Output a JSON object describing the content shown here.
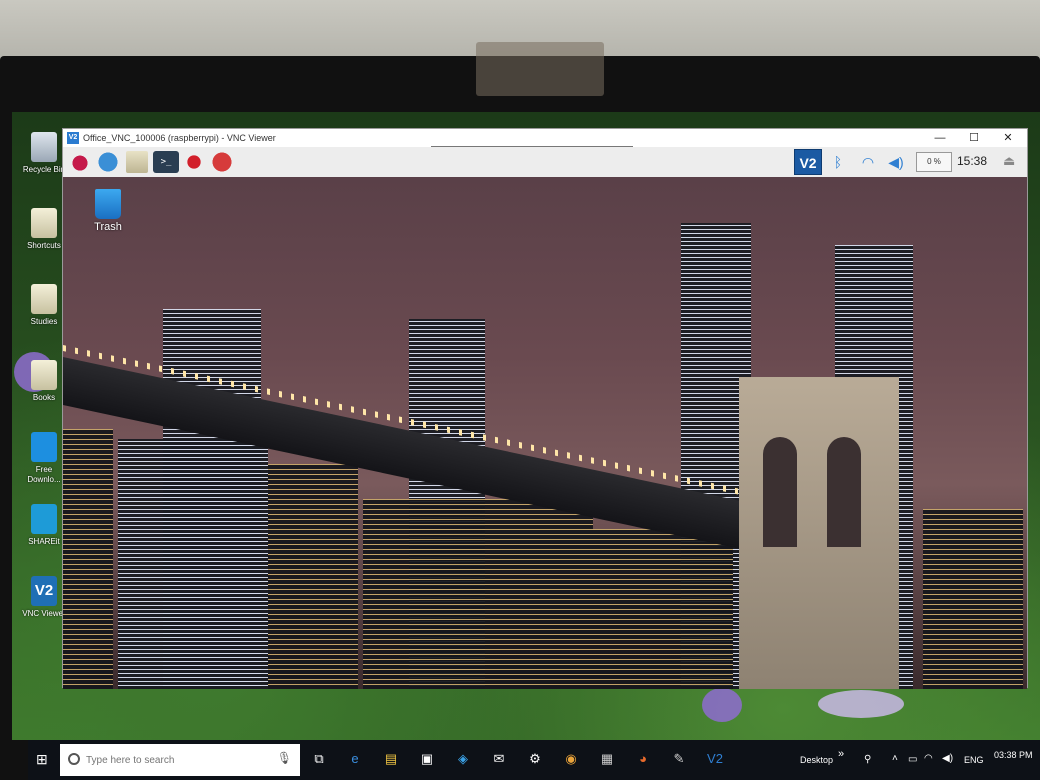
{
  "desktop_icons": [
    {
      "label": "Recycle Bin",
      "icon": "recycle-bin-icon"
    },
    {
      "label": "Shortcuts",
      "icon": "folder-icon"
    },
    {
      "label": "Studies",
      "icon": "folder-icon"
    },
    {
      "label": "Books",
      "icon": "folder-icon"
    },
    {
      "label": "Free Downlo...",
      "icon": "free-download-manager-icon"
    },
    {
      "label": "SHAREit",
      "icon": "shareit-icon"
    },
    {
      "label": "VNC Viewer",
      "icon": "vnc-viewer-icon"
    }
  ],
  "vnc_window": {
    "title": "Office_VNC_100006 (raspberrypi) - VNC Viewer",
    "logo_text": "V2",
    "controls": {
      "minimize": "—",
      "maximize": "☐",
      "close": "✕"
    }
  },
  "rpi_panel": {
    "terminal_glyph": ">_",
    "tray": {
      "vnc_badge": "V2",
      "bluetooth": "ᛒ",
      "wifi": "◠",
      "volume": "◀)",
      "cpu": "0 %",
      "clock": "15:38",
      "eject": "⏏"
    }
  },
  "remote_desktop": {
    "trash_label": "Trash"
  },
  "taskbar": {
    "start_glyph": "⊞",
    "search_placeholder": "Type here to search",
    "mic_glyph": "🎙",
    "pinned": [
      {
        "name": "task-view-icon",
        "glyph": "⧉",
        "color": "#ffffff"
      },
      {
        "name": "edge-icon",
        "glyph": "e",
        "color": "#3b8fe0"
      },
      {
        "name": "file-explorer-icon",
        "glyph": "▤",
        "color": "#f2c744"
      },
      {
        "name": "store-icon",
        "glyph": "▣",
        "color": "#ffffff"
      },
      {
        "name": "app-icon",
        "glyph": "◈",
        "color": "#3aa1e6"
      },
      {
        "name": "mail-icon",
        "glyph": "✉",
        "color": "#ffffff"
      },
      {
        "name": "settings-icon",
        "glyph": "⚙",
        "color": "#ffffff"
      },
      {
        "name": "chrome-icon",
        "glyph": "◉",
        "color": "#e8a33b"
      },
      {
        "name": "calculator-icon",
        "glyph": "▦",
        "color": "#cccccc"
      },
      {
        "name": "firefox-icon",
        "glyph": "◕",
        "color": "#e66a2c"
      },
      {
        "name": "paint-icon",
        "glyph": "✎",
        "color": "#cccccc"
      },
      {
        "name": "vnc-taskbar-icon",
        "glyph": "V2",
        "color": "#2f7fd2"
      }
    ],
    "desktop_label": "Desktop",
    "chevron": "»",
    "tray_lang": "ENG",
    "time": "03:38 PM"
  },
  "colors": {
    "taskbar_bg": "#0d1117",
    "rpi_panel_bg": "#ededed",
    "vnc_accent": "#1b5aa3"
  }
}
